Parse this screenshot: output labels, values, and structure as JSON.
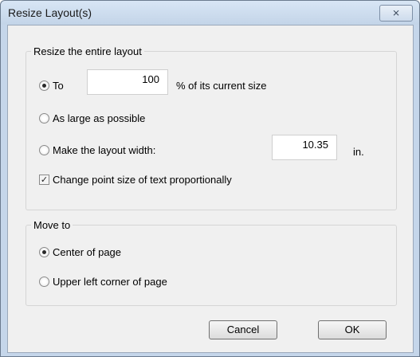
{
  "window": {
    "title": "Resize Layout(s)",
    "close_glyph": "⨯"
  },
  "resize_group": {
    "label": "Resize the entire layout",
    "to_label": "To",
    "percent_value": "100",
    "percent_suffix": "% of its current size",
    "as_large_label": "As large as possible",
    "make_width_label": "Make the layout width:",
    "width_value": "10.35",
    "width_unit": "in.",
    "change_point_label": "Change point size of text proportionally",
    "selected_option": "to",
    "change_point_checked": true
  },
  "move_group": {
    "label": "Move to",
    "center_label": "Center of page",
    "upper_left_label": "Upper left corner of page",
    "selected_option": "center"
  },
  "buttons": {
    "cancel": "Cancel",
    "ok": "OK"
  }
}
